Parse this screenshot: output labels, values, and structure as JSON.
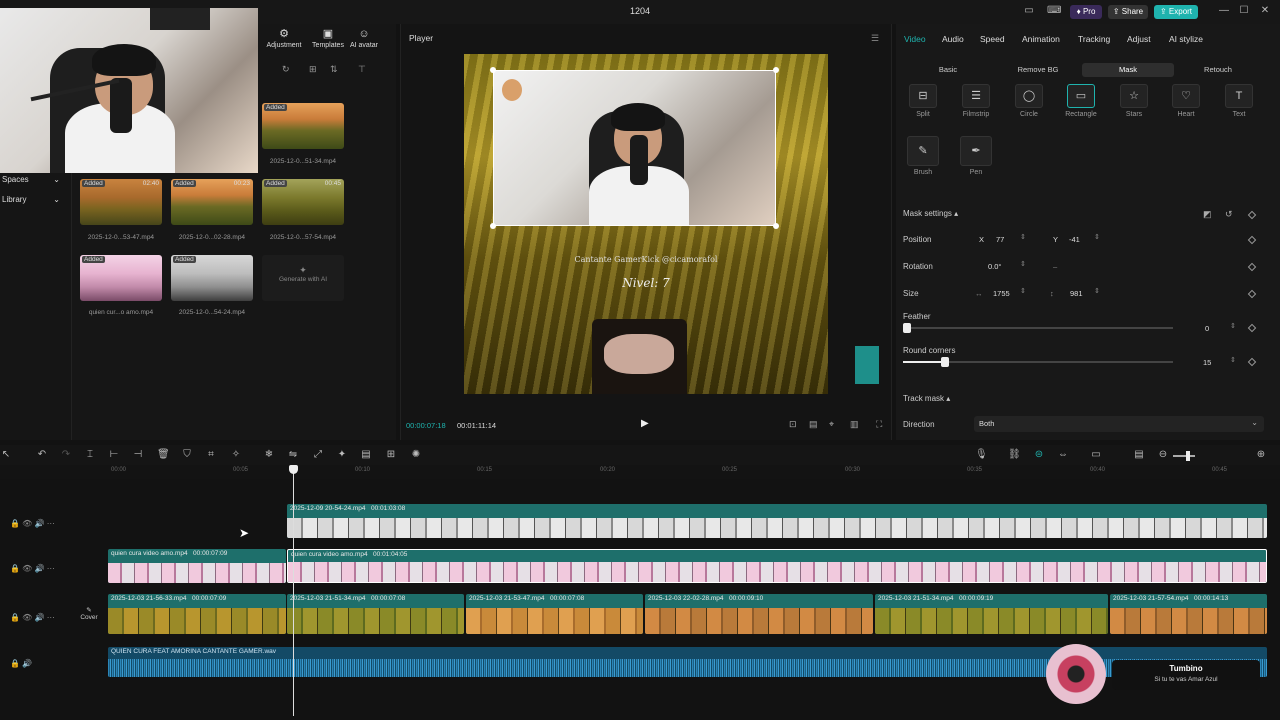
{
  "window": {
    "title": "1204",
    "pro_label": "Pro",
    "share_label": "Share",
    "export_label": "Export"
  },
  "media": {
    "tools": [
      {
        "label": "Adjustment"
      },
      {
        "label": "Templates"
      },
      {
        "label": "AI avatar"
      }
    ],
    "left_nav": [
      {
        "label": "Spaces"
      },
      {
        "label": "Library"
      }
    ],
    "clips": [
      {
        "badge": "Added",
        "duration": "",
        "caption": "2025-12-0...51-34.mp4"
      },
      {
        "badge": "Added",
        "duration": "02:40",
        "caption": "2025-12-0...53-47.mp4"
      },
      {
        "badge": "Added",
        "duration": "00:23",
        "caption": "2025-12-0...02-28.mp4"
      },
      {
        "badge": "Added",
        "duration": "00:45",
        "caption": "2025-12-0...57-54.mp4"
      },
      {
        "badge": "Added",
        "duration": "",
        "caption": "quien cur...o amo.mp4"
      },
      {
        "badge": "Added",
        "duration": "",
        "caption": "2025-12-0...54-24.mp4"
      }
    ],
    "generate_label": "Generate with AI"
  },
  "player": {
    "title": "Player",
    "current_time": "00:00:07:18",
    "total_time": "00:01:11:14",
    "overlay_text_1": "Cantante GamerKick @cicamorafol",
    "overlay_text_2": "Nivel: 7"
  },
  "properties": {
    "tabs": [
      {
        "label": "Video"
      },
      {
        "label": "Audio"
      },
      {
        "label": "Speed"
      },
      {
        "label": "Animation"
      },
      {
        "label": "Tracking"
      },
      {
        "label": "Adjust"
      },
      {
        "label": "AI stylize"
      }
    ],
    "subtabs": [
      {
        "label": "Basic"
      },
      {
        "label": "Remove BG"
      },
      {
        "label": "Mask"
      },
      {
        "label": "Retouch"
      }
    ],
    "shapes": [
      {
        "label": "Split",
        "icon": "split-icon"
      },
      {
        "label": "Filmstrip",
        "icon": "filmstrip-icon"
      },
      {
        "label": "Circle",
        "icon": "circle-icon"
      },
      {
        "label": "Rectangle",
        "icon": "rectangle-icon"
      },
      {
        "label": "Stars",
        "icon": "star-icon"
      },
      {
        "label": "Heart",
        "icon": "heart-icon"
      },
      {
        "label": "Text",
        "icon": "text-icon"
      }
    ],
    "shapes2": [
      {
        "label": "Brush",
        "icon": "brush-icon"
      },
      {
        "label": "Pen",
        "icon": "pen-icon"
      }
    ],
    "mask_settings_label": "Mask settings",
    "position_label": "Position",
    "pos_x_label": "X",
    "pos_x": "77",
    "pos_y_label": "Y",
    "pos_y": "-41",
    "rotation_label": "Rotation",
    "rotation": "0.0°",
    "size_label": "Size",
    "size_w": "1755",
    "size_h": "981",
    "feather_label": "Feather",
    "feather": "0",
    "round_label": "Round corners",
    "round": "15",
    "track_mask_label": "Track mask",
    "direction_label": "Direction",
    "direction": "Both",
    "accent": "#23b8b0"
  },
  "timeline": {
    "ruler": [
      "00:00",
      "00:05",
      "00:10",
      "00:15",
      "00:20",
      "00:25",
      "00:30",
      "00:35",
      "00:40",
      "00:45"
    ],
    "cover_label": "Cover",
    "track1": {
      "name": "2025-12-09 20-54-24.mp4",
      "duration": "00:01:03:08"
    },
    "track2": [
      {
        "name": "quien cura video amo.mp4",
        "duration": "00:00:07:09"
      },
      {
        "name": "quien cura video amo.mp4",
        "duration": "00:01:04:05"
      }
    ],
    "track3": [
      {
        "name": "2025-12-03 21-56-33.mp4",
        "duration": "00:00:07:09"
      },
      {
        "name": "2025-12-03 21-51-34.mp4",
        "duration": "00:00:07:08"
      },
      {
        "name": "2025-12-03 21-53-47.mp4",
        "duration": "00:00:07:08"
      },
      {
        "name": "2025-12-03 22-02-28.mp4",
        "duration": "00:00:09:10"
      },
      {
        "name": "2025-12-03 21-51-34.mp4",
        "duration": "00:00:09:19"
      },
      {
        "name": "2025-12-03 21-57-54.mp4",
        "duration": "00:00:14:13"
      }
    ],
    "audio": {
      "name": "QUIEN CURA FEAT AMORINA CANTANTE GAMER.wav"
    }
  },
  "music": {
    "title": "Tumbino",
    "subtitle": "Si tu te vas Amar Azul"
  }
}
